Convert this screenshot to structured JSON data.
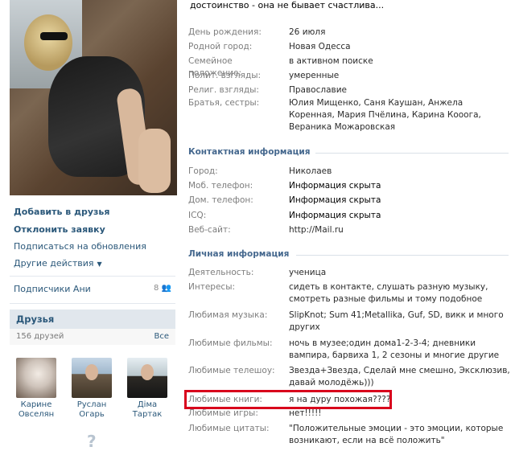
{
  "profile": {
    "top_line": "достоинство - она не бывает счастлива...",
    "actions": {
      "add_friend": "Добавить в друзья",
      "decline": "Отклонить заявку",
      "subscribe": "Подписаться на обновления",
      "other": "Другие действия"
    },
    "subscribers": {
      "label": "Подписчики Ани",
      "count": "8"
    },
    "friends": {
      "title": "Друзья",
      "count": "156 друзей",
      "all": "Все",
      "items": [
        {
          "first": "Карине",
          "last": "Овселян"
        },
        {
          "first": "Руслан",
          "last": "Огарь"
        },
        {
          "first": "Діма",
          "last": "Тартак"
        }
      ]
    }
  },
  "info": {
    "basic": [
      {
        "label": "День рождения:",
        "value": "26 июля"
      },
      {
        "label": "Родной город:",
        "value": "Новая Одесса"
      },
      {
        "label": "Семейное положение:",
        "value": "в активном поиске"
      },
      {
        "label": "Полит. взгляды:",
        "value": "умеренные"
      },
      {
        "label": "Религ. взгляды:",
        "value": "Православие"
      },
      {
        "label": "Братья, сестры:",
        "value": "Юлия Мищенко, Саня Каушан, Анжела Коренная, Мария Пчёлина, Карина Кооога, Вераника Можаровская"
      }
    ],
    "contact_title": "Контактная информация",
    "contact": [
      {
        "label": "Город:",
        "value": "Николаев"
      },
      {
        "label": "Моб. телефон:",
        "value": "Информация скрыта"
      },
      {
        "label": "Дом. телефон:",
        "value": "Информация скрыта"
      },
      {
        "label": "ICQ:",
        "value": "Информация скрыта"
      },
      {
        "label": "Веб-сайт:",
        "value": "http://Mail.ru"
      }
    ],
    "personal_title": "Личная информация",
    "personal": [
      {
        "label": "Деятельность:",
        "value": "ученица"
      },
      {
        "label": "Интересы:",
        "value": "сидеть в контакте, слушать разную музыку, смотреть разные фильмы и тому подобное"
      },
      {
        "label": "Любимая музыка:",
        "value": "SlipKnot; Sum 41;Metallika, Guf, SD, викк и много других"
      },
      {
        "label": "Любимые фильмы:",
        "value": "ночь в музее;один дома1-2-3-4; дневники вампира, барвиха 1, 2 сезоны и многие другие"
      },
      {
        "label": "Любимые телешоу:",
        "value": "Звезда+Звезда, Сделай мне смешно, Эксклюзив, давай молодёжь)))"
      },
      {
        "label": "Любимые книги:",
        "value": "я на дуру похожая????"
      },
      {
        "label": "Любимые игры:",
        "value": "нет!!!!!"
      },
      {
        "label": "Любимые цитаты:",
        "value": "\"Положительные эмоции - это эмоции, которые возникают, если на всё положить\""
      }
    ]
  },
  "colors": {
    "link": "#2b587a",
    "label": "#7d7d7d",
    "highlight": "#d8001c",
    "section": "#45688e"
  }
}
